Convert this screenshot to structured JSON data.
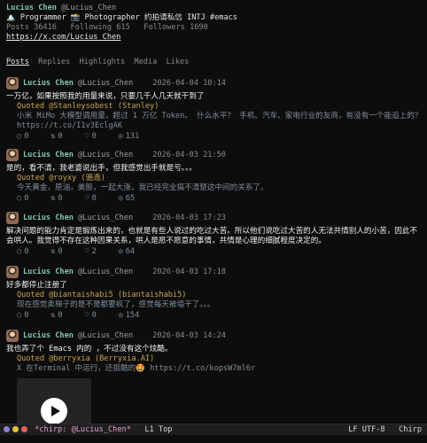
{
  "profile": {
    "name": "Lucius Chen",
    "handle": "@Lucius_Chen",
    "bio": "🏔️ Programmer 📸 Photographer 约拍请私信 INTJ #emacs",
    "posts_label": "Posts",
    "posts": "36416",
    "following_label": "Following",
    "following": "615",
    "followers_label": "Followers",
    "followers": "1690",
    "url": "https://x.com/Lucius_Chen"
  },
  "tabs": [
    "Posts",
    "Replies",
    "Highlights",
    "Media",
    "Likes"
  ],
  "tweets": [
    {
      "name": "Lucius Chen",
      "handle": "@Lucius_Chen",
      "date": "2026-04-04 10:14",
      "text": "一万亿，如果按照我的用量来说，只要几千人几天就干到了",
      "quote_by": "Quoted @Stanleysobest (Stanley)",
      "quote_text": "小米 MiMo 大模型调用量，超过 1 万亿 Token。 什么水平？ 手机、汽车、家电行业的友商，有没有一个能追上的？ https://t.co/I1v3EclgAK",
      "replies": "0",
      "retweets": "0",
      "likes": "0",
      "views": "131"
    },
    {
      "name": "Lucius Chen",
      "handle": "@Lucius_Chen",
      "date": "2026-04-03 21:50",
      "text": "是的，看不清，我老婆说出手，但我感觉出手就是亏。。。",
      "quote_by": "Quoted @royxy (骆逸)",
      "quote_text": "今天黄金，原油，美股，一起大涨，我已经完全搞不清楚这中间的关系了。",
      "replies": "0",
      "retweets": "0",
      "likes": "0",
      "views": "65"
    },
    {
      "name": "Lucius Chen",
      "handle": "@Lucius_Chen",
      "date": "2026-04-03 17:23",
      "text": "解决问题的能力肯定是锻炼出来的，也就是有些人说过的吃过大苦。所以他们说吃过大苦的人无法共情别人的小苦，因此不会哄人。我觉得不存在这种因果关系，哄人是愿不愿意的事情，共情是心理的细腻程度决定的。",
      "replies": "0",
      "retweets": "0",
      "likes": "2",
      "views": "64"
    },
    {
      "name": "Lucius Chen",
      "handle": "@Lucius_Chen",
      "date": "2026-04-03 17:18",
      "text": "好多都停止注册了",
      "quote_by": "Quoted @biantaishabi5 (biantaishabi5)",
      "quote_text": "现在感觉卖梯子的是不是都要疯了，感觉每天被墙干了。。。",
      "replies": "0",
      "retweets": "0",
      "likes": "0",
      "views": "154"
    },
    {
      "name": "Lucius Chen",
      "handle": "@Lucius_Chen",
      "date": "2026-04-03 14:24",
      "text": "我也弄了个 Emacs 内的 ，不过没有这个炫酷。",
      "quote_by": "Quoted @berryxia (Berryxia.AI)",
      "quote_text": "X 在Terminal 中运行，还挺酷的🤩 https://t.co/kopsW7ml6r"
    }
  ],
  "modeline": {
    "buffer": "*chirp: @Lucius_Chen*",
    "position": "L1 Top",
    "encoding": "LF UTF-8",
    "mode": "Chirp"
  },
  "colors": {
    "accent": "#7fc8a9",
    "quote_author": "#c9a356",
    "muted": "#7f8e99"
  },
  "icons": [
    "reply-icon",
    "retweet-icon",
    "like-icon",
    "views-icon",
    "play-icon"
  ]
}
